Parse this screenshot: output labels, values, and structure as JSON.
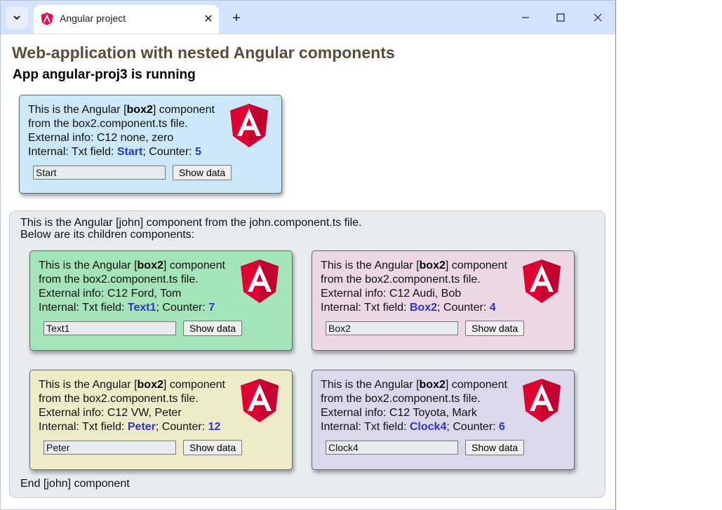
{
  "browser": {
    "tab_title": "Angular project",
    "tab_close": "✕",
    "new_tab": "+",
    "icons": {
      "tab_dropdown": "chevron-down-icon",
      "favicon": "angular-icon",
      "minimize": "minimize-icon",
      "maximize": "maximize-icon",
      "close": "close-icon"
    }
  },
  "page": {
    "heading": "Web-application with nested Angular components",
    "subheading": "App angular-proj3 is running"
  },
  "box_common": {
    "line1_prefix": "This is the Angular [",
    "component_name": "box2",
    "line1_suffix": "] component",
    "line2": "from the box2.component.ts file.",
    "external_prefix": "External info: ",
    "internal_prefix": "Internal: Txt field: ",
    "counter_label": "; Counter: ",
    "button_label": "Show data"
  },
  "top_box": {
    "external": "C12 none, zero",
    "txt": "Start",
    "counter": "5",
    "input_value": "Start",
    "bg": "#cce8f8"
  },
  "john": {
    "intro_line1": "This is the Angular [john] component from the john.component.ts file.",
    "intro_line2": "Below are its children components:",
    "end_text": "End [john] component",
    "children": [
      {
        "external": "C12 Ford, Tom",
        "txt": "Text1",
        "counter": "7",
        "input_value": "Text1",
        "bg": "#a3e4b8"
      },
      {
        "external": "C12 Audi, Bob",
        "txt": "Box2",
        "counter": "4",
        "input_value": "Box2",
        "bg": "#ecd8e2"
      },
      {
        "external": "C12 VW, Peter",
        "txt": "Peter",
        "counter": "12",
        "input_value": "Peter",
        "bg": "#eeecc8"
      },
      {
        "external": "C12 Toyota, Mark",
        "txt": "Clock4",
        "counter": "6",
        "input_value": "Clock4",
        "bg": "#dcd8ec"
      }
    ]
  },
  "colors": {
    "angular_red": "#dd0031",
    "angular_dark": "#c3002f",
    "value_blue": "#3333cc",
    "heading_brown": "#5a4b3a"
  }
}
